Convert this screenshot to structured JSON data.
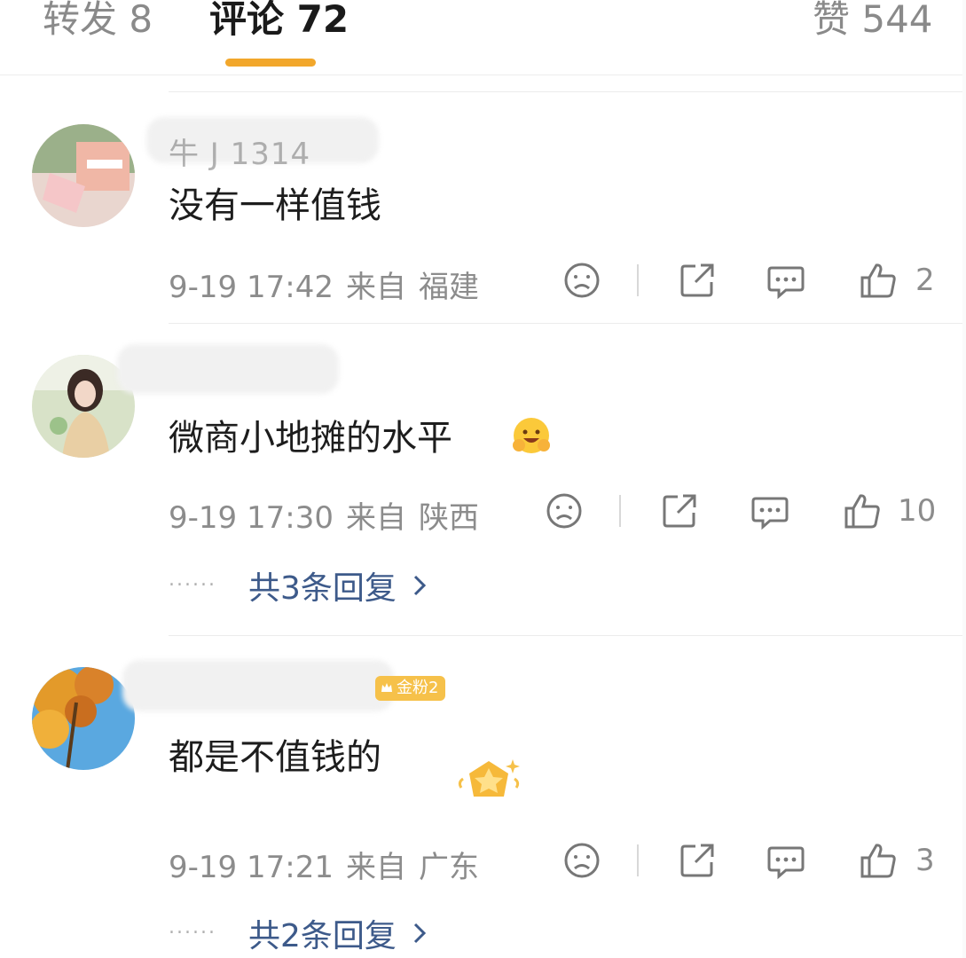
{
  "tabs": [
    {
      "label": "转发 8"
    },
    {
      "label": "评论 72",
      "active": true
    },
    {
      "label": "赞 544"
    }
  ],
  "comments": [
    {
      "name_fragment": "牛 J  1314",
      "text": "没有一样值钱",
      "time": "9-19 17:42",
      "from_label": "来自",
      "region": "福建",
      "likes": "2",
      "replies_label": ""
    },
    {
      "name_fragment": "",
      "text": "微商小地摊的水平",
      "emoji": "hugging-face-emoji",
      "time": "9-19 17:30",
      "from_label": "来自",
      "region": "陕西",
      "likes": "10",
      "replies_label": "共3条回复"
    },
    {
      "name_fragment": "",
      "badge": "金粉2",
      "text": "都是不值钱的",
      "time": "9-19 17:21",
      "from_label": "来自",
      "region": "广东",
      "likes": "3",
      "replies_label": "共2条回复"
    }
  ],
  "icons": {
    "dislike": "sad-face-icon",
    "share": "share-icon",
    "comment": "comment-bubble-icon",
    "like": "thumbs-up-icon",
    "chevron": "chevron-right-icon"
  },
  "colors": {
    "tab_underline": "#f2a72b",
    "reply_link": "#3d5a8a",
    "meta_text": "#8c8c8c",
    "badge": "#f6c14a"
  }
}
